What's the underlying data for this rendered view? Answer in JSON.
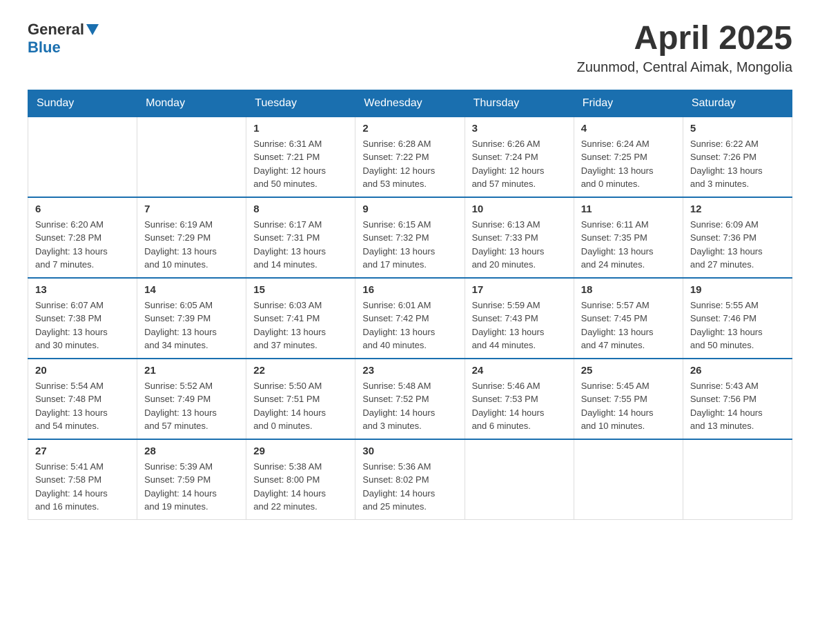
{
  "header": {
    "logo": {
      "general": "General",
      "blue": "Blue"
    },
    "month": "April 2025",
    "location": "Zuunmod, Central Aimak, Mongolia"
  },
  "weekdays": [
    "Sunday",
    "Monday",
    "Tuesday",
    "Wednesday",
    "Thursday",
    "Friday",
    "Saturday"
  ],
  "weeks": [
    [
      {
        "day": "",
        "info": ""
      },
      {
        "day": "",
        "info": ""
      },
      {
        "day": "1",
        "info": "Sunrise: 6:31 AM\nSunset: 7:21 PM\nDaylight: 12 hours\nand 50 minutes."
      },
      {
        "day": "2",
        "info": "Sunrise: 6:28 AM\nSunset: 7:22 PM\nDaylight: 12 hours\nand 53 minutes."
      },
      {
        "day": "3",
        "info": "Sunrise: 6:26 AM\nSunset: 7:24 PM\nDaylight: 12 hours\nand 57 minutes."
      },
      {
        "day": "4",
        "info": "Sunrise: 6:24 AM\nSunset: 7:25 PM\nDaylight: 13 hours\nand 0 minutes."
      },
      {
        "day": "5",
        "info": "Sunrise: 6:22 AM\nSunset: 7:26 PM\nDaylight: 13 hours\nand 3 minutes."
      }
    ],
    [
      {
        "day": "6",
        "info": "Sunrise: 6:20 AM\nSunset: 7:28 PM\nDaylight: 13 hours\nand 7 minutes."
      },
      {
        "day": "7",
        "info": "Sunrise: 6:19 AM\nSunset: 7:29 PM\nDaylight: 13 hours\nand 10 minutes."
      },
      {
        "day": "8",
        "info": "Sunrise: 6:17 AM\nSunset: 7:31 PM\nDaylight: 13 hours\nand 14 minutes."
      },
      {
        "day": "9",
        "info": "Sunrise: 6:15 AM\nSunset: 7:32 PM\nDaylight: 13 hours\nand 17 minutes."
      },
      {
        "day": "10",
        "info": "Sunrise: 6:13 AM\nSunset: 7:33 PM\nDaylight: 13 hours\nand 20 minutes."
      },
      {
        "day": "11",
        "info": "Sunrise: 6:11 AM\nSunset: 7:35 PM\nDaylight: 13 hours\nand 24 minutes."
      },
      {
        "day": "12",
        "info": "Sunrise: 6:09 AM\nSunset: 7:36 PM\nDaylight: 13 hours\nand 27 minutes."
      }
    ],
    [
      {
        "day": "13",
        "info": "Sunrise: 6:07 AM\nSunset: 7:38 PM\nDaylight: 13 hours\nand 30 minutes."
      },
      {
        "day": "14",
        "info": "Sunrise: 6:05 AM\nSunset: 7:39 PM\nDaylight: 13 hours\nand 34 minutes."
      },
      {
        "day": "15",
        "info": "Sunrise: 6:03 AM\nSunset: 7:41 PM\nDaylight: 13 hours\nand 37 minutes."
      },
      {
        "day": "16",
        "info": "Sunrise: 6:01 AM\nSunset: 7:42 PM\nDaylight: 13 hours\nand 40 minutes."
      },
      {
        "day": "17",
        "info": "Sunrise: 5:59 AM\nSunset: 7:43 PM\nDaylight: 13 hours\nand 44 minutes."
      },
      {
        "day": "18",
        "info": "Sunrise: 5:57 AM\nSunset: 7:45 PM\nDaylight: 13 hours\nand 47 minutes."
      },
      {
        "day": "19",
        "info": "Sunrise: 5:55 AM\nSunset: 7:46 PM\nDaylight: 13 hours\nand 50 minutes."
      }
    ],
    [
      {
        "day": "20",
        "info": "Sunrise: 5:54 AM\nSunset: 7:48 PM\nDaylight: 13 hours\nand 54 minutes."
      },
      {
        "day": "21",
        "info": "Sunrise: 5:52 AM\nSunset: 7:49 PM\nDaylight: 13 hours\nand 57 minutes."
      },
      {
        "day": "22",
        "info": "Sunrise: 5:50 AM\nSunset: 7:51 PM\nDaylight: 14 hours\nand 0 minutes."
      },
      {
        "day": "23",
        "info": "Sunrise: 5:48 AM\nSunset: 7:52 PM\nDaylight: 14 hours\nand 3 minutes."
      },
      {
        "day": "24",
        "info": "Sunrise: 5:46 AM\nSunset: 7:53 PM\nDaylight: 14 hours\nand 6 minutes."
      },
      {
        "day": "25",
        "info": "Sunrise: 5:45 AM\nSunset: 7:55 PM\nDaylight: 14 hours\nand 10 minutes."
      },
      {
        "day": "26",
        "info": "Sunrise: 5:43 AM\nSunset: 7:56 PM\nDaylight: 14 hours\nand 13 minutes."
      }
    ],
    [
      {
        "day": "27",
        "info": "Sunrise: 5:41 AM\nSunset: 7:58 PM\nDaylight: 14 hours\nand 16 minutes."
      },
      {
        "day": "28",
        "info": "Sunrise: 5:39 AM\nSunset: 7:59 PM\nDaylight: 14 hours\nand 19 minutes."
      },
      {
        "day": "29",
        "info": "Sunrise: 5:38 AM\nSunset: 8:00 PM\nDaylight: 14 hours\nand 22 minutes."
      },
      {
        "day": "30",
        "info": "Sunrise: 5:36 AM\nSunset: 8:02 PM\nDaylight: 14 hours\nand 25 minutes."
      },
      {
        "day": "",
        "info": ""
      },
      {
        "day": "",
        "info": ""
      },
      {
        "day": "",
        "info": ""
      }
    ]
  ]
}
